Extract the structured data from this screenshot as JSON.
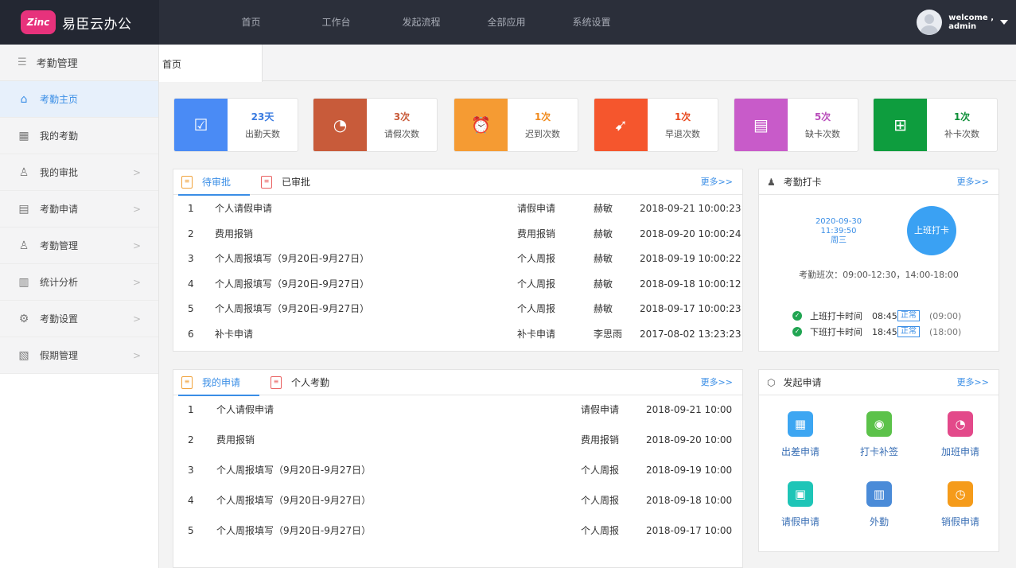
{
  "brand": {
    "logo_text": "Zinc",
    "name": "易臣云办公"
  },
  "nav": [
    "首页",
    "工作台",
    "发起流程",
    "全部应用",
    "系统设置"
  ],
  "user": {
    "greeting": "welcome ,",
    "name": "admin"
  },
  "sidebar": {
    "title": "考勤管理",
    "items": [
      {
        "label": "考勤主页",
        "icon": "home-icon",
        "active": true
      },
      {
        "label": "我的考勤",
        "icon": "calendar-icon"
      },
      {
        "label": "我的审批",
        "icon": "user-icon"
      },
      {
        "label": "考勤申请",
        "icon": "form-icon"
      },
      {
        "label": "考勤管理",
        "icon": "user-manage-icon"
      },
      {
        "label": "统计分析",
        "icon": "chart-icon"
      },
      {
        "label": "考勤设置",
        "icon": "gear-icon"
      },
      {
        "label": "假期管理",
        "icon": "doc-icon"
      }
    ]
  },
  "tab": {
    "label": "首页"
  },
  "stats": [
    {
      "value": "23天",
      "label": "出勤天数",
      "color": "#4a8bf5",
      "value_color": "#3a7be0",
      "icon": "calendar-check-icon"
    },
    {
      "value": "3次",
      "label": "请假次数",
      "color": "#c85b3a",
      "value_color": "#c85b3a",
      "icon": "clock-minus-icon"
    },
    {
      "value": "1次",
      "label": "迟到次数",
      "color": "#f59b33",
      "value_color": "#f08a1c",
      "icon": "alarm-icon"
    },
    {
      "value": "1次",
      "label": "早退次数",
      "color": "#f5562d",
      "value_color": "#e8491f",
      "icon": "runner-icon"
    },
    {
      "value": "5次",
      "label": "缺卡次数",
      "color": "#c85bc9",
      "value_color": "#b94dbb",
      "icon": "card-icon"
    },
    {
      "value": "1次",
      "label": "补卡次数",
      "color": "#0e9d3e",
      "value_color": "#0e8f38",
      "icon": "add-card-icon"
    }
  ],
  "approvals": {
    "tabs": [
      "待审批",
      "已审批"
    ],
    "more": "更多>>",
    "rows": [
      {
        "no": "1",
        "title": "个人请假申请",
        "type": "请假申请",
        "person": "赫敏",
        "time": "2018-09-21 10:00:23"
      },
      {
        "no": "2",
        "title": "费用报销",
        "type": "费用报销",
        "person": "赫敏",
        "time": "2018-09-20 10:00:24"
      },
      {
        "no": "3",
        "title": "个人周报填写（9月20日-9月27日）",
        "type": "个人周报",
        "person": "赫敏",
        "time": "2018-09-19 10:00:22"
      },
      {
        "no": "4",
        "title": "个人周报填写（9月20日-9月27日）",
        "type": "个人周报",
        "person": "赫敏",
        "time": "2018-09-18 10:00:12"
      },
      {
        "no": "5",
        "title": "个人周报填写（9月20日-9月27日）",
        "type": "个人周报",
        "person": "赫敏",
        "time": "2018-09-17 10:00:23"
      },
      {
        "no": "6",
        "title": "补卡申请",
        "type": "补卡申请",
        "person": "李思雨",
        "time": "2017-08-02 13:23:23"
      }
    ]
  },
  "punch": {
    "title": "考勤打卡",
    "more": "更多>>",
    "date": "2020-09-30",
    "time": "11:39:50",
    "weekday": "周三",
    "button": "上班打卡",
    "shift": "考勤班次：09:00-12:30，14:00-18:00",
    "records": [
      {
        "label": "上班打卡时间",
        "time": "08:45",
        "status": "正常",
        "plan": "(09:00)"
      },
      {
        "label": "下班打卡时间",
        "time": "18:45",
        "status": "正常",
        "plan": "(18:00)"
      }
    ]
  },
  "requests": {
    "tabs": [
      "我的申请",
      "个人考勤"
    ],
    "more": "更多>>",
    "rows": [
      {
        "no": "1",
        "title": "个人请假申请",
        "type": "请假申请",
        "time": "2018-09-21 10:00"
      },
      {
        "no": "2",
        "title": "费用报销",
        "type": "费用报销",
        "time": "2018-09-20 10:00"
      },
      {
        "no": "3",
        "title": "个人周报填写（9月20日-9月27日）",
        "type": "个人周报",
        "time": "2018-09-19 10:00"
      },
      {
        "no": "4",
        "title": "个人周报填写（9月20日-9月27日）",
        "type": "个人周报",
        "time": "2018-09-18 10:00"
      },
      {
        "no": "5",
        "title": "个人周报填写（9月20日-9月27日）",
        "type": "个人周报",
        "time": "2018-09-17 10:00"
      }
    ]
  },
  "launch": {
    "title": "发起申请",
    "more": "更多>>",
    "apps": [
      {
        "label": "出差申请",
        "color": "#3da6f2",
        "icon": "travel-icon"
      },
      {
        "label": "打卡补签",
        "color": "#5cc24a",
        "icon": "sign-icon"
      },
      {
        "label": "加班申请",
        "color": "#e3498a",
        "icon": "overtime-icon"
      },
      {
        "label": "请假申请",
        "color": "#1ec5b7",
        "icon": "leave-icon"
      },
      {
        "label": "外勤",
        "color": "#4a8bd8",
        "icon": "field-icon"
      },
      {
        "label": "销假申请",
        "color": "#f59b1a",
        "icon": "cancel-leave-icon"
      }
    ]
  }
}
